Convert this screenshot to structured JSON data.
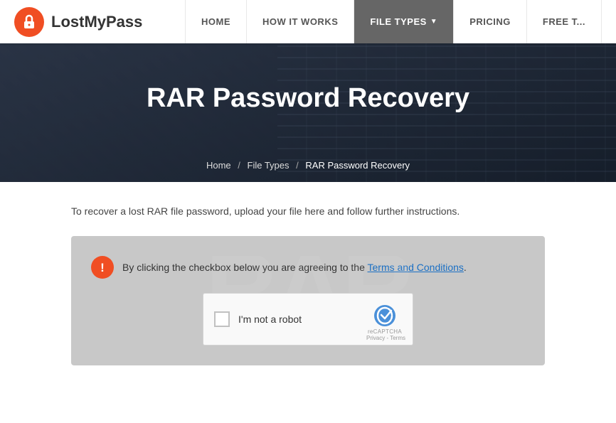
{
  "brand": {
    "name": "LostMyPass"
  },
  "nav": {
    "items": [
      {
        "id": "home",
        "label": "HOME",
        "active": false,
        "hasChevron": false
      },
      {
        "id": "how-it-works",
        "label": "HOW IT WORKS",
        "active": false,
        "hasChevron": false
      },
      {
        "id": "file-types",
        "label": "FILE TYPES",
        "active": true,
        "hasChevron": true
      },
      {
        "id": "pricing",
        "label": "PRICING",
        "active": false,
        "hasChevron": false
      },
      {
        "id": "free-t",
        "label": "FREE T...",
        "active": false,
        "hasChevron": false
      }
    ]
  },
  "hero": {
    "title": "RAR Password Recovery"
  },
  "breadcrumb": {
    "home": "Home",
    "file_types": "File Types",
    "current": "RAR Password Recovery"
  },
  "main": {
    "intro_text": "To recover a lost RAR file password, upload your file here and follow further instructions.",
    "notice_text": "By clicking the checkbox below you are agreeing to the ",
    "terms_label": "Terms and Conditions",
    "notice_end": ".",
    "captcha_label": "I'm not a robot",
    "captcha_brand": "reCAPTCHA",
    "captcha_privacy": "Privacy",
    "captcha_terms": "Terms"
  }
}
